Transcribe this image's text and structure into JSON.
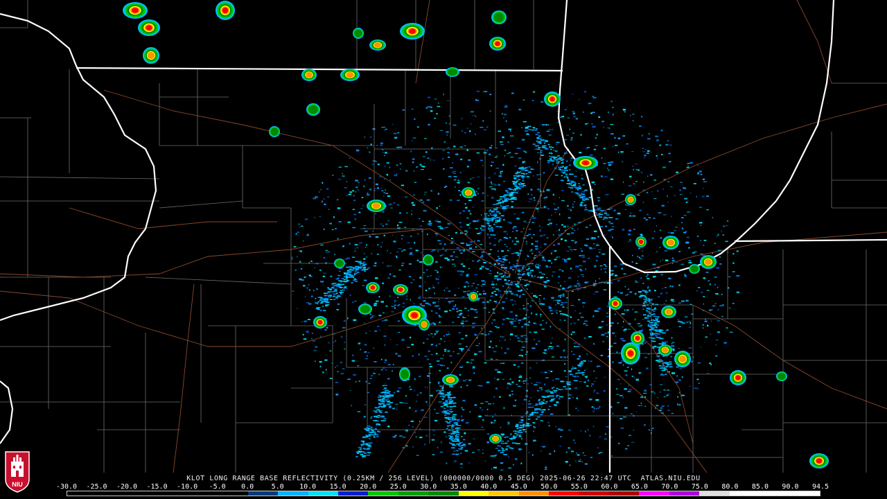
{
  "product": {
    "title_text": "KLOT LONG RANGE BASE REFLECTIVITY (0.25KM / 256 LEVEL) (000000/0000 0.5 DEG) 2025-06-26 22:47 UTC  ATLAS.NIU.EDU",
    "text_color": "#f0f0f0"
  },
  "color_scale": {
    "labels": [
      "-30.0",
      "-25.0",
      "-20.0",
      "-15.0",
      "-10.0",
      "-5.0",
      "0.0",
      "5.0",
      "10.0",
      "15.0",
      "20.0",
      "25.0",
      "30.0",
      "35.0",
      "40.0",
      "45.0",
      "50.0",
      "55.0",
      "60.0",
      "65.0",
      "70.0",
      "75.0",
      "80.0",
      "85.0",
      "90.0",
      "94.5"
    ],
    "label_color": "#ffffff",
    "colors": [
      "#000000",
      "#000000",
      "#000000",
      "#000000",
      "#000000",
      "#000000",
      "#0a3a78",
      "#00b4ff",
      "#00e0f0",
      "#0020d0",
      "#00c800",
      "#00a000",
      "#008a00",
      "#ffff00",
      "#ffc800",
      "#ff9000",
      "#ff0000",
      "#d00000",
      "#b00000",
      "#ff00ff",
      "#b000e0",
      "#e0e0e0",
      "#ffffff",
      "#ffffff",
      "#ffffff"
    ]
  },
  "map": {
    "background": "#000000",
    "county_color": "#6e6e6e",
    "state_color": "#ffffff",
    "highway_color": "#8b4a2a",
    "radar_site_icon": "radar-center"
  },
  "logo": {
    "icon": "niu-logo",
    "text": "NIU",
    "color": "#c8102e"
  }
}
